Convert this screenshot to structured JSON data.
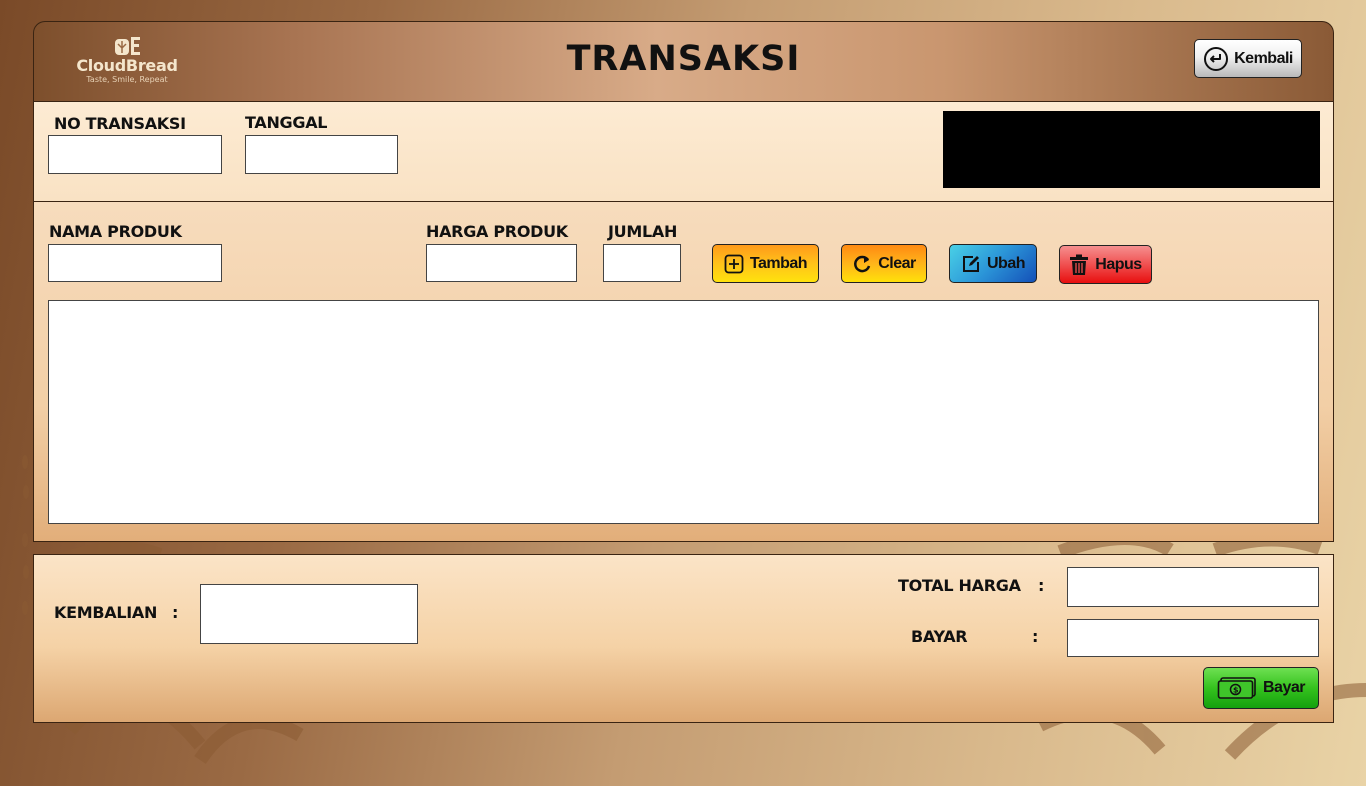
{
  "header": {
    "logo_name": "CloudBread",
    "logo_tagline": "Taste, Smile, Repeat",
    "title": "TRANSAKSI",
    "back_button_label": "Kembali"
  },
  "form_top": {
    "no_transaksi_label": "NO TRANSAKSI",
    "tanggal_label": "TANGGAL",
    "no_transaksi_value": "",
    "tanggal_value": ""
  },
  "form_product": {
    "nama_produk_label": "NAMA PRODUK",
    "harga_produk_label": "HARGA PRODUK",
    "jumlah_label": "JUMLAH",
    "nama_produk_value": "",
    "harga_produk_value": "",
    "jumlah_value": ""
  },
  "actions": {
    "tambah_label": "Tambah",
    "clear_label": "Clear",
    "ubah_label": "Ubah",
    "hapus_label": "Hapus"
  },
  "payment": {
    "kembalian_label": "KEMBALIAN",
    "kembalian_colon": ":",
    "total_harga_label": "TOTAL HARGA",
    "total_harga_colon": ":",
    "bayar_label": "BAYAR",
    "bayar_colon": ":",
    "kembalian_value": "",
    "total_harga_value": "",
    "bayar_value": "",
    "bayar_button_label": "Bayar"
  },
  "icons": {
    "logo": "bread-wheat-icon",
    "back": "return-arrow-icon",
    "tambah": "plus-square-icon",
    "clear": "refresh-icon",
    "ubah": "edit-icon",
    "hapus": "trash-icon",
    "bayar": "money-bill-icon"
  },
  "colors": {
    "header_brown": "#8a5a36",
    "panel_cream": "#fdebd3",
    "tambah_orange": "#ffc21a",
    "ubah_blue": "#2b95d8",
    "hapus_red": "#f05050",
    "bayar_green": "#35c21e"
  }
}
